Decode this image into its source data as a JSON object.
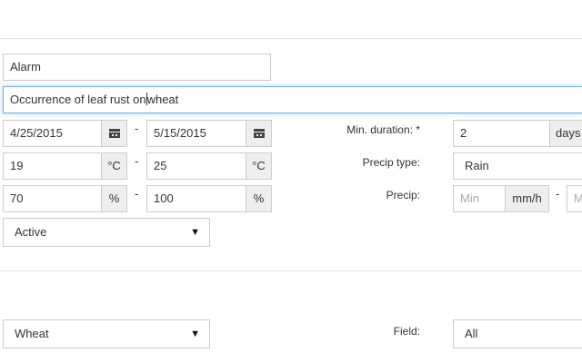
{
  "form": {
    "name": "Alarm",
    "description_before_cursor": "Occurrence of leaf rust on",
    "description_after_cursor": "wheat",
    "date_from": "4/25/2015",
    "date_to": "5/15/2015",
    "dash": "-",
    "temp_min": "19",
    "temp_max": "25",
    "temp_unit": "°C",
    "humidity_min": "70",
    "humidity_max": "100",
    "humidity_unit": "%",
    "status": "Active",
    "min_duration_label": "Min. duration: *",
    "min_duration_value": "2",
    "min_duration_unit": "days",
    "precip_type_label": "Precip type:",
    "precip_type_value": "Rain",
    "precip_label": "Precip:",
    "precip_min_placeholder": "Min",
    "precip_unit": "mm/h",
    "precip_max_placeholder": "M"
  },
  "crop": {
    "value": "Wheat",
    "field_label": "Field:",
    "field_value": "All"
  },
  "icons": {
    "calendar": "calendar-icon",
    "dropdown": "caret-down-icon"
  }
}
